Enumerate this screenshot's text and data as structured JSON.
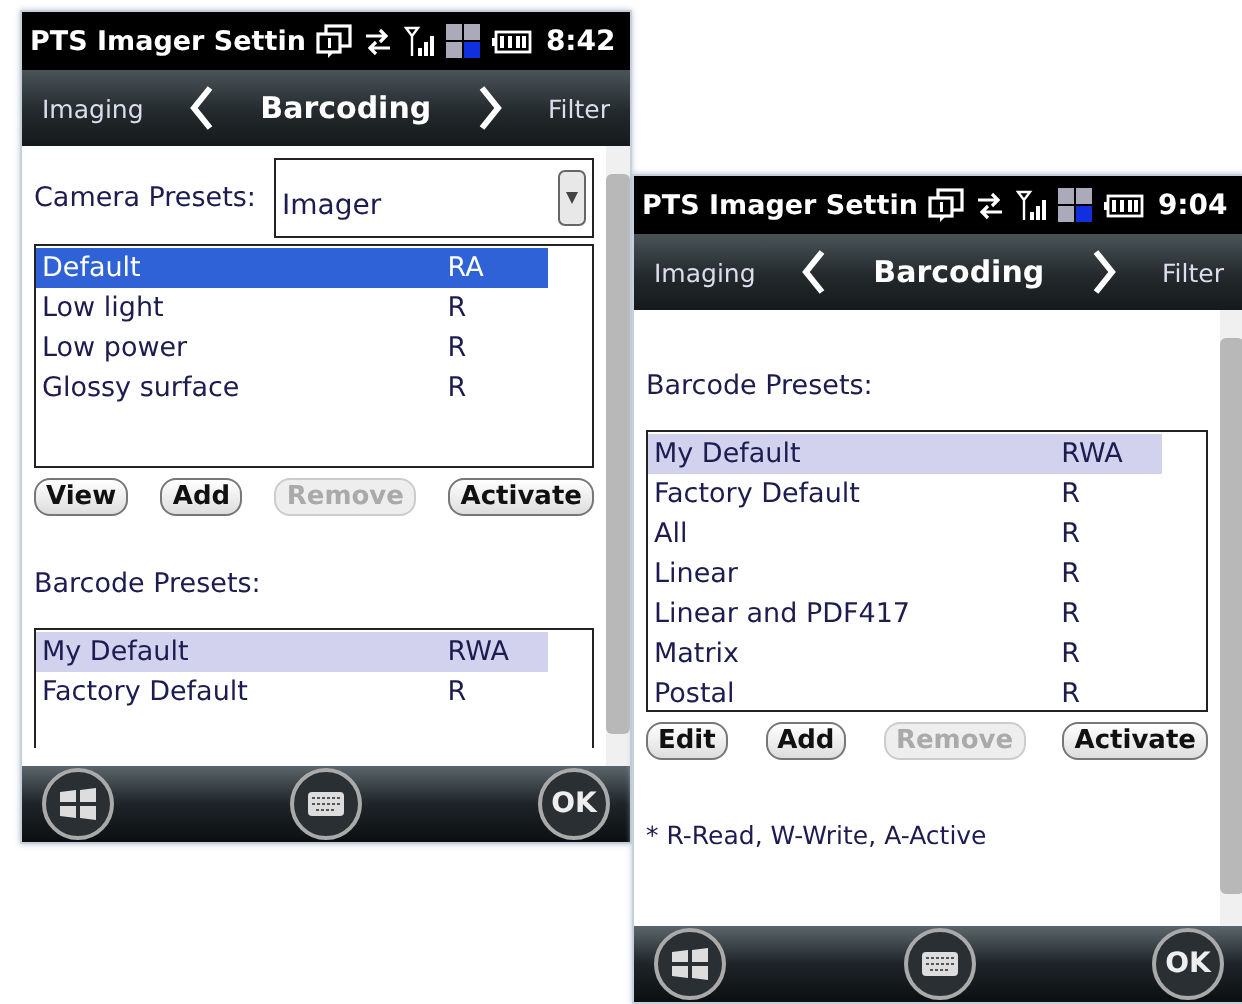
{
  "screens": [
    {
      "status_bar": {
        "title": "PTS Imager Settin",
        "time": "8:42"
      },
      "nav": {
        "previous": "Imaging",
        "current": "Barcoding",
        "next": "Filter"
      },
      "sections": [
        {
          "label": "Camera Presets:",
          "dropdown": {
            "value": "Imager"
          },
          "list": {
            "focused": true,
            "rows": [
              {
                "name": "Default",
                "access": "RA",
                "selected": true
              },
              {
                "name": "Low light",
                "access": "R",
                "selected": false
              },
              {
                "name": "Low power",
                "access": "R",
                "selected": false
              },
              {
                "name": "Glossy surface",
                "access": "R",
                "selected": false
              }
            ]
          },
          "buttons": [
            {
              "label": "View",
              "disabled": false
            },
            {
              "label": "Add",
              "disabled": false
            },
            {
              "label": "Remove",
              "disabled": true
            },
            {
              "label": "Activate",
              "disabled": false
            }
          ]
        },
        {
          "label": "Barcode Presets:",
          "list": {
            "focused": false,
            "rows": [
              {
                "name": "My Default",
                "access": "RWA",
                "selected": true
              },
              {
                "name": "Factory Default",
                "access": "R",
                "selected": false
              }
            ]
          }
        }
      ],
      "taskbar": {
        "ok": "OK"
      }
    },
    {
      "status_bar": {
        "title": "PTS Imager Settin",
        "time": "9:04"
      },
      "nav": {
        "previous": "Imaging",
        "current": "Barcoding",
        "next": "Filter"
      },
      "sections": [
        {
          "label": "Barcode Presets:",
          "list": {
            "focused": false,
            "rows": [
              {
                "name": "My Default",
                "access": "RWA",
                "selected": true
              },
              {
                "name": "Factory Default",
                "access": "R",
                "selected": false
              },
              {
                "name": "All",
                "access": "R",
                "selected": false
              },
              {
                "name": "Linear",
                "access": "R",
                "selected": false
              },
              {
                "name": "Linear and PDF417",
                "access": "R",
                "selected": false
              },
              {
                "name": "Matrix",
                "access": "R",
                "selected": false
              },
              {
                "name": "Postal",
                "access": "R",
                "selected": false
              }
            ]
          },
          "buttons": [
            {
              "label": "Edit",
              "disabled": false
            },
            {
              "label": "Add",
              "disabled": false
            },
            {
              "label": "Remove",
              "disabled": true
            },
            {
              "label": "Activate",
              "disabled": false
            }
          ],
          "note": "* R-Read, W-Write, A-Active"
        }
      ],
      "taskbar": {
        "ok": "OK"
      }
    }
  ]
}
